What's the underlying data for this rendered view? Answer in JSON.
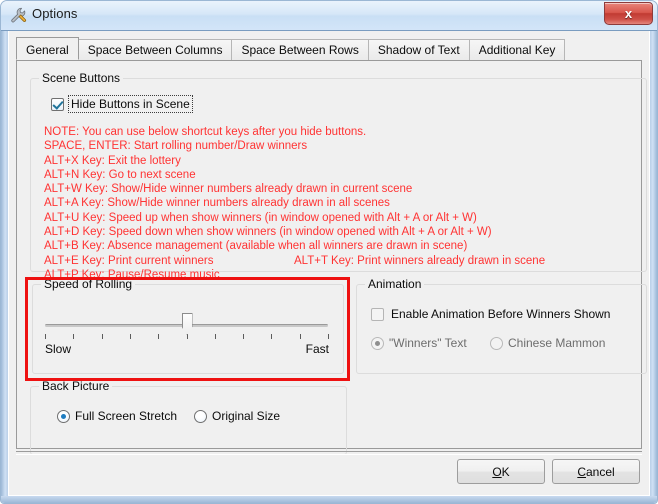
{
  "window": {
    "title": "Options",
    "icon": "wrench-icon",
    "close_label": "x"
  },
  "tabs": [
    {
      "label": "General",
      "active": true
    },
    {
      "label": "Space Between Columns",
      "active": false
    },
    {
      "label": "Space Between Rows",
      "active": false
    },
    {
      "label": "Shadow of Text",
      "active": false
    },
    {
      "label": "Additional Key",
      "active": false
    }
  ],
  "scene_buttons": {
    "group_title": "Scene Buttons",
    "hide_buttons_checkbox": {
      "label": "Hide Buttons in Scene",
      "checked": true,
      "focused": true
    },
    "note_color": "#ff3333",
    "shortcut_lines": [
      "NOTE: You can use below shortcut keys after you hide buttons.",
      "SPACE, ENTER: Start rolling number/Draw winners",
      "ALT+X Key: Exit the lottery",
      "ALT+N Key: Go to next scene",
      "ALT+W Key: Show/Hide winner numbers already drawn in current scene",
      "ALT+A Key: Show/Hide winner numbers already drawn in all scenes",
      "ALT+U Key: Speed up when show winners (in window opened with Alt + A or Alt + W)",
      "ALT+D Key: Speed down when show winners (in window opened with Alt + A or Alt + W)",
      "ALT+B Key: Absence management (available when all winners are drawn in scene)",
      "ALT+E Key: Print current winners",
      "ALT+P Key: Pause/Resume music"
    ],
    "shortcut_right_line": "ALT+T Key: Print winners already drawn in scene",
    "shortcut_right_on_index": 9
  },
  "speed_of_rolling": {
    "group_title": "Speed of Rolling",
    "min_label": "Slow",
    "max_label": "Fast",
    "tick_count": 11,
    "value": 6,
    "highlight_color": "#ee1111"
  },
  "animation": {
    "group_title": "Animation",
    "enable_checkbox": {
      "label": "Enable Animation Before Winners Shown",
      "checked": false,
      "disabled": true
    },
    "options": [
      {
        "label": "\"Winners\" Text",
        "selected": true,
        "disabled": true
      },
      {
        "label": "Chinese Mammon",
        "selected": false,
        "disabled": true
      }
    ]
  },
  "back_picture": {
    "group_title": "Back Picture",
    "options": [
      {
        "label": "Full Screen Stretch",
        "selected": true
      },
      {
        "label": "Original Size",
        "selected": false
      }
    ]
  },
  "footer": {
    "ok": {
      "accel": "O",
      "rest": "K"
    },
    "cancel": {
      "accel": "C",
      "rest": "ancel"
    }
  }
}
